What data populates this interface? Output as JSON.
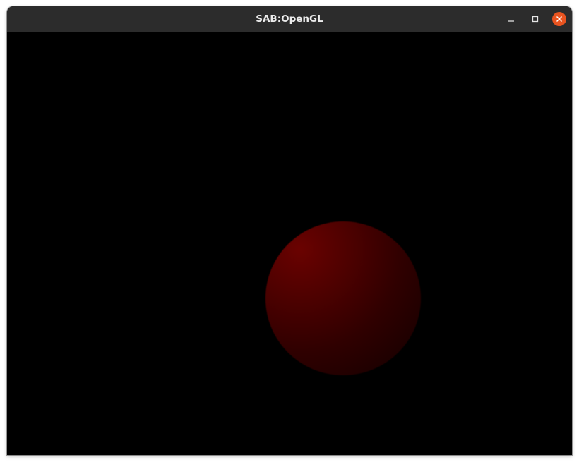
{
  "window": {
    "title": "SAB:OpenGL",
    "controls": {
      "minimize_icon": "minimize-icon",
      "maximize_icon": "maximize-icon",
      "close_icon": "close-icon"
    }
  },
  "colors": {
    "titlebar": "#2c2c2c",
    "title_text": "#ececec",
    "close_button": "#e95420",
    "canvas_background": "#000000",
    "sphere_highlight": "#6a0200",
    "sphere_shadow": "#160000"
  }
}
